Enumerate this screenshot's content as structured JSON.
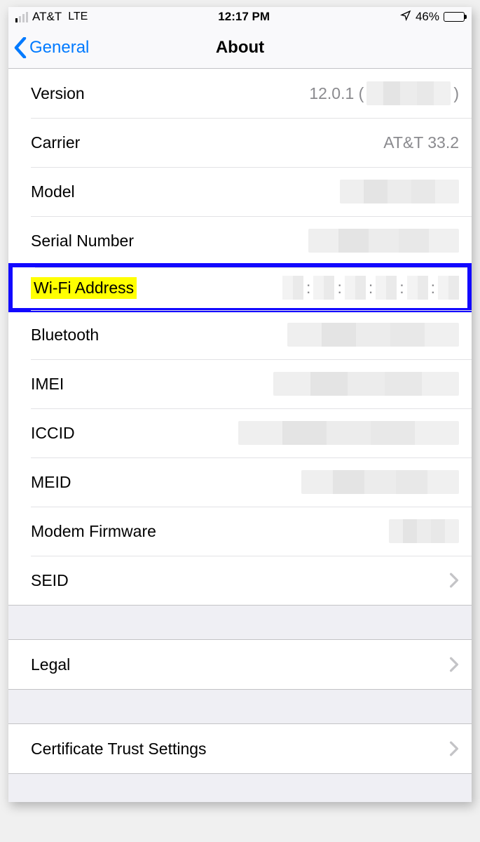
{
  "status": {
    "carrier": "AT&T",
    "network": "LTE",
    "time": "12:17 PM",
    "battery_pct": "46%"
  },
  "nav": {
    "back": "General",
    "title": "About"
  },
  "rows": {
    "version_label": "Version",
    "version_prefix": "12.0.1 (",
    "version_suffix": ")",
    "carrier_label": "Carrier",
    "carrier_value": "AT&T 33.2",
    "model_label": "Model",
    "serial_label": "Serial Number",
    "wifi_label": "Wi-Fi Address",
    "bluetooth_label": "Bluetooth",
    "imei_label": "IMEI",
    "iccid_label": "ICCID",
    "meid_label": "MEID",
    "modem_label": "Modem Firmware",
    "seid_label": "SEID",
    "legal_label": "Legal",
    "cert_label": "Certificate Trust Settings"
  },
  "mac_sep": ":"
}
